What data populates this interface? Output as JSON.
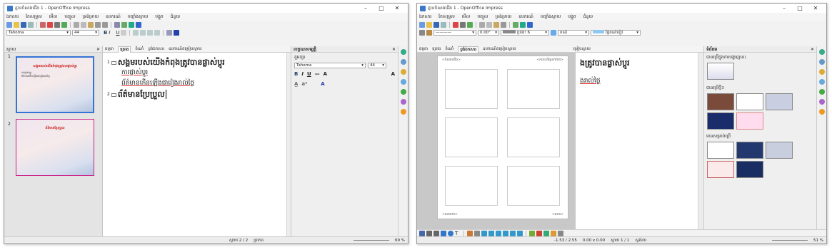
{
  "window1": {
    "title": "គ្មានចំណងជើង 1 - OpenOffice Impress",
    "menu": [
      "ឯកសារ",
      "កែសម្រួល",
      "មើល",
      "បញ្ចូល",
      "ទ្រង់ទ្រាយ",
      "ឧបករណ៍",
      "បញ្ចាំងស្លាយ",
      "បង្អួច",
      "ជំនួយ"
    ],
    "font_name": "Tahoma",
    "font_size": "44",
    "slides_pane_title": "ស្លាយ",
    "slide1_title": "សង្គមរបស់យើងកំពុងត្រូវបានផ្លាស់ប្ដូរ",
    "slide1_line1": "ការផ្លាស់ប្ដូរ",
    "slide1_line2": "ព័ត៌មានកើនឡើងជារៀងរាល់ថ្ងៃ",
    "slide2_title": "ព័ត៌មានប្រែប្រួល",
    "tabs": [
      "ធម្មតា",
      "គ្រោង",
      "ចំណាំ",
      "ប្លង់ឯកសារ",
      "ឧបករណ៍តម្រៀបស្លាយ"
    ],
    "active_tab": "គ្រោង",
    "outline": {
      "title1": "សង្គមរបស់យើងកំពុងត្រូវបានផ្លាស់ប្ដូរ",
      "sub1": "ការផ្លាស់ប្ដូរ",
      "sub2": "ព័ត៌មានកើនឡើងជារៀងរាល់ថ្ងៃ",
      "title2": "ព័ត៌មានប្រែប្រួល"
    },
    "props_title": "លក្ខណសម្បត្តិ",
    "props_section": "តួអក្សរ",
    "props_font": "Tahoma",
    "props_size": "44",
    "status_slide": "ស្លាយ 2 / 2",
    "status_layout": "ប្រាកដ",
    "zoom": "69 %"
  },
  "window2": {
    "title": "គ្មានចំណងជើង 1 - OpenOffice Impress",
    "menu": [
      "ឯកសារ",
      "កែសម្រួល",
      "មើល",
      "បញ្ចូល",
      "ទ្រង់ទ្រាយ",
      "ឧបករណ៍",
      "បញ្ចាំងស្លាយ",
      "បង្អួច",
      "ជំនួយ"
    ],
    "line_width": "0.00\"",
    "color_name": "ប្រផេះ 6",
    "fill_name": "ពណ៌",
    "area_name": "ផ្ទៃពណ៌ខៀវ",
    "tabs": [
      "ធម្មតា",
      "គ្រោង",
      "ចំណាំ",
      "ប្លង់ឯកសារ",
      "ឧបករណ៍តម្រៀបស្លាយ"
    ],
    "active_tab": "ប្លង់ឯកសារ",
    "page_header_left": "<ចំណងជើង>",
    "page_header_right": "<កាលបរិច្ឆេទ/ម៉ោង>",
    "page_footer_left": "<បាតកថា>",
    "page_footer_right": "<លេខ>",
    "outline_peek1": "ងត្រូវបានផ្លាស់ប្ដូរ",
    "outline_peek2": "ងរាល់ថ្ងៃ",
    "outline_tab": "ម្រៀបស្លាយ",
    "side_title": "ទំព័រមេ",
    "side_sections": [
      "បានប្រើក្នុងការបង្ហាញនេះ",
      "បានប្រើថ្មីៗ",
      "មានសម្រាប់ប្រើ"
    ],
    "status_pos": "-1.53 / 2.55",
    "status_size": "0.00 x 0.00",
    "status_page": "ស្លាយ 1 / 1",
    "status_layout": "ស្តង់ដារ",
    "zoom": "51 %"
  }
}
